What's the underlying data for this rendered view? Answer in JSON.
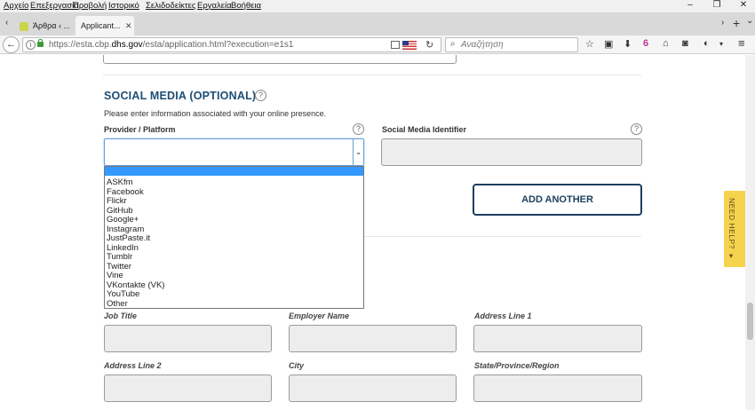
{
  "menubar": {
    "items": [
      "Αρχείο",
      "Επεξεργασία",
      "Προβολή",
      "Ιστορικό",
      "Σελιδοδείκτες",
      "Εργαλεία",
      "Βοήθεια"
    ]
  },
  "window_controls": {
    "minimize": "–",
    "restore": "❐",
    "close": "✕"
  },
  "tabs": [
    {
      "label": "Άρθρα ‹ ...",
      "active": false
    },
    {
      "label": "Applicant...",
      "active": true
    }
  ],
  "tabbar": {
    "close_glyph": "✕",
    "new_tab": "+",
    "overflow_right": "›",
    "overflow_down": "⌄"
  },
  "navbar": {
    "back_glyph": "←",
    "url_prefix": "https://esta.cbp.",
    "url_domain": "dhs.gov",
    "url_suffix": "/esta/application.html?execution=e1s1",
    "reload_glyph": "↻",
    "search_placeholder": "Αναζήτηση"
  },
  "toolbar_icons": [
    "star-icon",
    "clipboard-icon",
    "download-icon",
    "extension-icon",
    "home-icon",
    "pocket-icon",
    "shield-icon",
    "menu-icon"
  ],
  "social_media": {
    "title": "SOCIAL MEDIA (OPTIONAL)",
    "description": "Please enter information associated with your online presence.",
    "provider_label": "Provider / Platform",
    "identifier_label": "Social Media Identifier",
    "help_glyph": "?",
    "add_another": "ADD ANOTHER",
    "options": [
      "ASKfm",
      "Facebook",
      "Flickr",
      "GitHub",
      "Google+",
      "Instagram",
      "JustPaste.it",
      "LinkedIn",
      "Tumblr",
      "Twitter",
      "Vine",
      "VKontakte (VK)",
      "YouTube",
      "Other"
    ]
  },
  "employment": {
    "job_title": "Job Title",
    "employer_name": "Employer Name",
    "address_line_1": "Address Line 1",
    "address_line_2": "Address Line 2",
    "city": "City",
    "state": "State/Province/Region"
  },
  "need_help": "NEED HELP? ▾",
  "colors": {
    "heading": "#1d4e74",
    "button_border": "#1d3e5e",
    "selection": "#3399ff",
    "need_help_bg": "#f6d34f"
  }
}
